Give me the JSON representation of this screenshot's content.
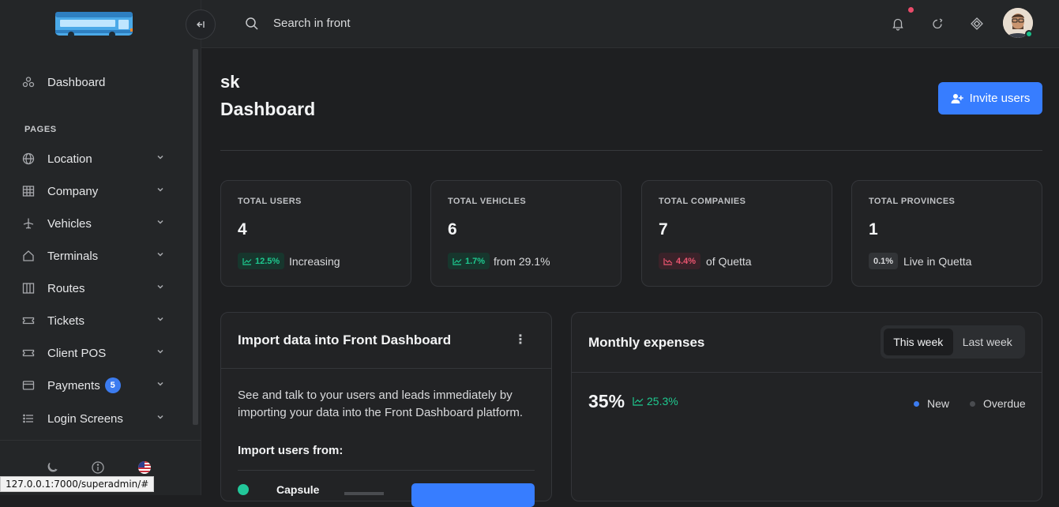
{
  "sidebar": {
    "dashboard_label": "Dashboard",
    "section_title": "PAGES",
    "items": [
      {
        "label": "Location",
        "icon": "globe-icon"
      },
      {
        "label": "Company",
        "icon": "table-icon"
      },
      {
        "label": "Vehicles",
        "icon": "airplane-icon"
      },
      {
        "label": "Terminals",
        "icon": "home-icon"
      },
      {
        "label": "Routes",
        "icon": "map-icon"
      },
      {
        "label": "Tickets",
        "icon": "ticket-icon"
      },
      {
        "label": "Client POS",
        "icon": "ticket-icon"
      },
      {
        "label": "Payments",
        "icon": "card-icon",
        "badge": "5"
      },
      {
        "label": "Login Screens",
        "icon": "list-icon"
      }
    ]
  },
  "status_bar": {
    "url": "127.0.0.1:7000/superadmin/#"
  },
  "topbar": {
    "search_placeholder": "Search in front"
  },
  "header": {
    "subtitle": "sk",
    "title": "Dashboard",
    "invite_label": "Invite users"
  },
  "stats": [
    {
      "label": "TOTAL USERS",
      "value": "4",
      "chip": "12.5%",
      "trend": "up",
      "note": "Increasing"
    },
    {
      "label": "TOTAL VEHICLES",
      "value": "6",
      "chip": "1.7%",
      "trend": "up",
      "note": "from 29.1%"
    },
    {
      "label": "TOTAL COMPANIES",
      "value": "7",
      "chip": "4.4%",
      "trend": "down",
      "note": "of Quetta"
    },
    {
      "label": "TOTAL PROVINCES",
      "value": "1",
      "chip": "0.1%",
      "trend": "neutral",
      "note": "Live in Quetta"
    }
  ],
  "import_panel": {
    "title": "Import data into Front Dashboard",
    "description": "See and talk to your users and leads immediately by importing your data into the Front Dashboard platform.",
    "import_from": "Import users from:",
    "source_label": "Capsule"
  },
  "expenses_panel": {
    "title": "Monthly expenses",
    "tab_active": "This week",
    "tab_inactive": "Last week",
    "value": "35%",
    "change": "25.3%",
    "legend_new": "New",
    "legend_overdue": "Overdue"
  },
  "colors": {
    "accent": "#377dff",
    "success": "#1ec98f",
    "danger": "#ec5570",
    "legend_new": "#3c7cf0",
    "legend_overdue": "#4a4c50"
  }
}
